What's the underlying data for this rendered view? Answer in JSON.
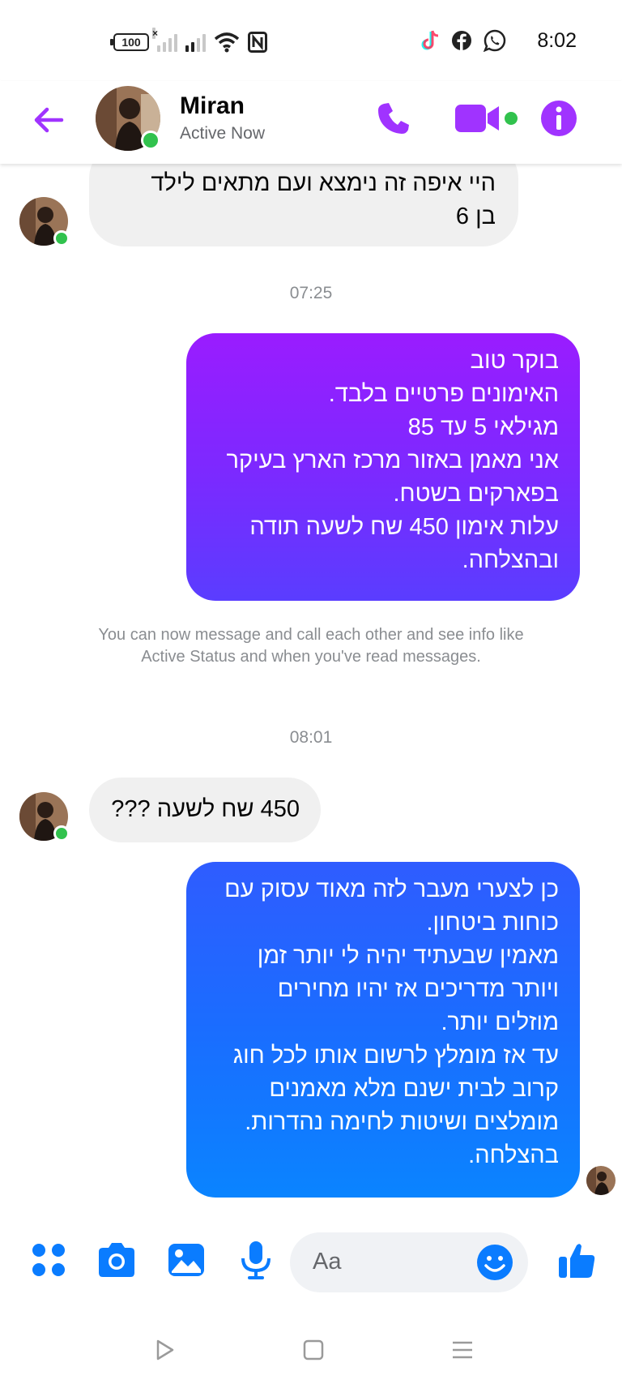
{
  "status_bar": {
    "battery": "100",
    "time": "8:02",
    "icons": [
      "signal-off-icon",
      "signal-icon",
      "wifi-icon",
      "nfc-icon",
      "tiktok-icon",
      "facebook-icon",
      "whatsapp-icon"
    ]
  },
  "header": {
    "name": "Miran",
    "status": "Active Now",
    "icons": [
      "back-arrow-icon",
      "phone-icon",
      "video-icon",
      "info-icon"
    ],
    "accent": "#a033ff"
  },
  "messages": [
    {
      "from": "them",
      "text": "היי איפה זה נימצא ועם מתאים לילד\nבן 6"
    },
    {
      "type": "timestamp",
      "text": "07:25"
    },
    {
      "from": "me",
      "text": "בוקר טוב\nהאימונים פרטיים בלבד.\nמגילאי 5 עד 85\nאני מאמן באזור מרכז הארץ בעיקר\nבפארקים בשטח.\nעלות אימון 450 שח לשעה תודה\nובהצלחה."
    },
    {
      "type": "notice",
      "text": "You can now message and call each other and see info like Active Status and when you've read messages."
    },
    {
      "type": "timestamp",
      "text": "08:01"
    },
    {
      "from": "them",
      "text": "450 שח לשעה ???"
    },
    {
      "from": "me",
      "text": "כן לצערי מעבר לזה מאוד עסוק עם\nכוחות ביטחון.\nמאמין שבעתיד יהיה לי יותר זמן\nויותר מדריכים אז יהיו מחירים\nמוזלים יותר.\nעד אז מומלץ לרשום אותו לכל חוג\nקרוב לבית ישנם מלא מאמנים\nמומלצים ושיטות לחימה נהדרות.\nבהצלחה."
    }
  ],
  "composer": {
    "placeholder": "Aa",
    "icons": [
      "menu-dots-icon",
      "camera-icon",
      "gallery-icon",
      "microphone-icon",
      "emoji-icon",
      "thumbs-up-icon"
    ],
    "accent": "#0a7cff"
  },
  "nav": {
    "icons": [
      "back-triangle-icon",
      "home-square-icon",
      "recents-menu-icon"
    ]
  }
}
